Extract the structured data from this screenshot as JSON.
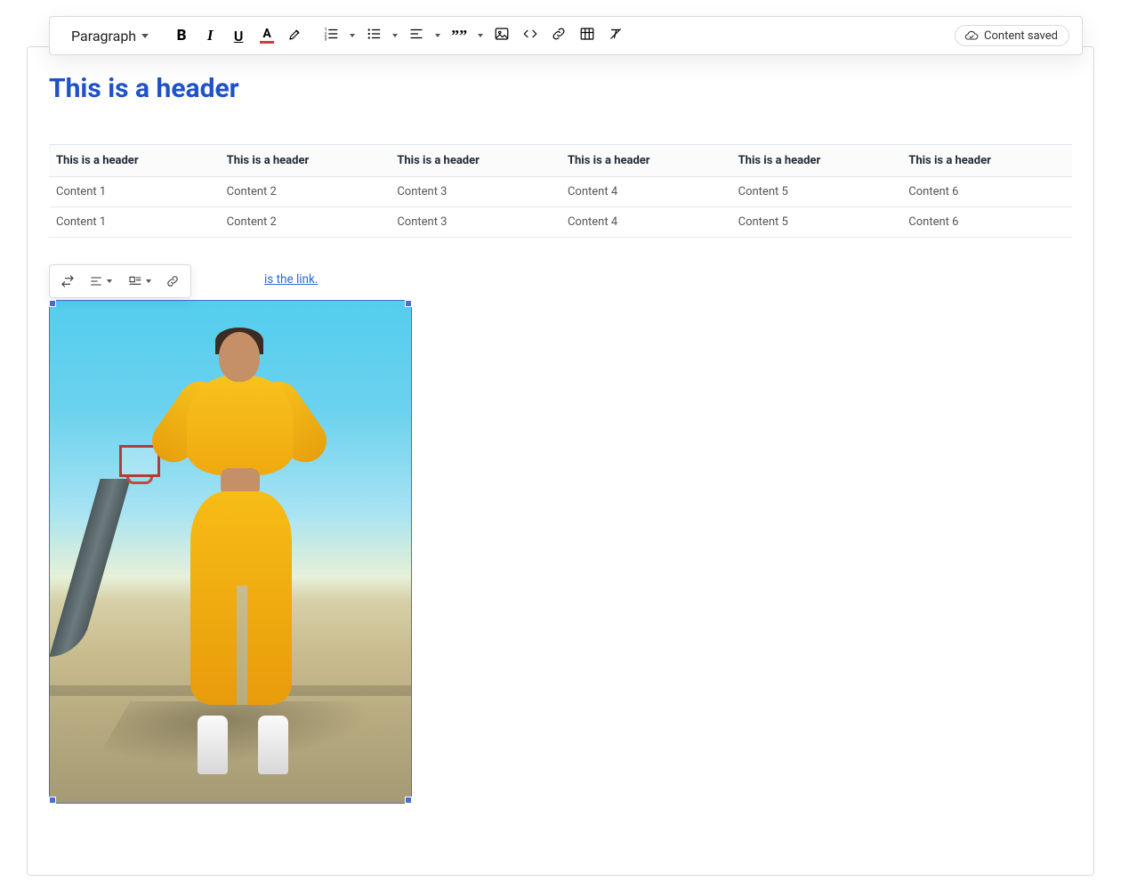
{
  "toolbar": {
    "paragraph_label": "Paragraph",
    "saved_label": "Content saved"
  },
  "doc": {
    "header": "This is a header",
    "table": {
      "headers": [
        "This is a header",
        "This is a header",
        "This is a header",
        "This is a header",
        "This is a header",
        "This is a header"
      ],
      "rows": [
        [
          "Content 1",
          "Content 2",
          "Content 3",
          "Content 4",
          "Content 5",
          "Content 6"
        ],
        [
          "Content 1",
          "Content 2",
          "Content 3",
          "Content 4",
          "Content 5",
          "Content 6"
        ]
      ]
    },
    "link_tail": "is the link."
  }
}
